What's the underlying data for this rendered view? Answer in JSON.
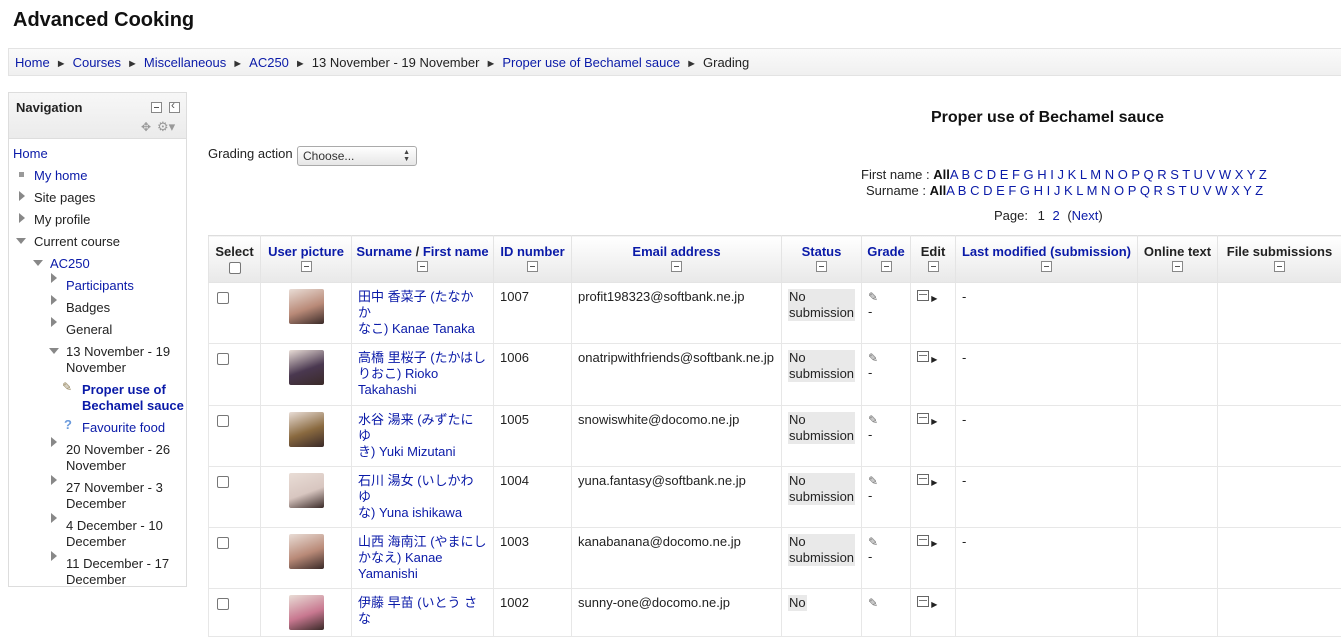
{
  "site": {
    "title": "Advanced Cooking"
  },
  "breadcrumb": [
    {
      "label": "Home",
      "link": true
    },
    {
      "label": "Courses",
      "link": true
    },
    {
      "label": "Miscellaneous",
      "link": true
    },
    {
      "label": "AC250",
      "link": true
    },
    {
      "label": "13 November - 19 November",
      "link": false
    },
    {
      "label": "Proper use of Bechamel sauce",
      "link": true
    },
    {
      "label": "Grading",
      "link": false
    }
  ],
  "navigation": {
    "title": "Navigation",
    "home": "Home",
    "my_home": "My home",
    "site_pages": "Site pages",
    "my_profile": "My profile",
    "current_course": "Current course",
    "course": "AC250",
    "participants": "Participants",
    "badges": "Badges",
    "general": "General",
    "week1": "13 November - 19 November",
    "assignment": "Proper use of Bechamel sauce",
    "favourite": "Favourite food",
    "week2": "20 November - 26 November",
    "week3": "27 November - 3 December",
    "week4": "4 December - 10 December",
    "week5": "11 December - 17 December"
  },
  "main": {
    "heading": "Proper use of Bechamel sauce",
    "grading_action_label": "Grading action",
    "grading_action_value": "Choose...",
    "first_name_label": "First name :",
    "surname_label": "Surname :",
    "all_label": "All",
    "letters": "A B C D E F G H I J K L M N O P Q R S T U V W X Y Z",
    "page_label": "Page:",
    "page_1": "1",
    "page_2": "2",
    "next_label": "Next"
  },
  "table": {
    "headers": {
      "select": "Select",
      "user_picture": "User picture",
      "surname": "Surname",
      "slash": " / ",
      "first_name": "First name",
      "id_number": "ID number",
      "email": "Email address",
      "status": "Status",
      "grade": "Grade",
      "edit": "Edit",
      "last_modified": "Last modified (submission)",
      "online_text": "Online text",
      "file_submissions": "File submissions"
    },
    "rows": [
      {
        "name_line1": "田中 香菜子 (たなか か",
        "name_line2": "なこ) Kanae Tanaka",
        "id": "1007",
        "email": "profit198323@softbank.ne.jp",
        "status1": "No",
        "status2": "submission",
        "grade": "-",
        "modified": "-",
        "avatar_color": "#b98a78"
      },
      {
        "name_line1": "高橋 里桜子 (たかはし",
        "name_line2": "りおこ) Rioko",
        "name_line3": "Takahashi",
        "id": "1006",
        "email": "onatripwithfriends@softbank.ne.jp",
        "status1": "No",
        "status2": "submission",
        "grade": "-",
        "modified": "-",
        "avatar_color": "#4a3850"
      },
      {
        "name_line1": "水谷 湯来 (みずたに ゆ",
        "name_line2": "き) Yuki Mizutani",
        "id": "1005",
        "email": "snowiswhite@docomo.ne.jp",
        "status1": "No",
        "status2": "submission",
        "grade": "-",
        "modified": "-",
        "avatar_color": "#8a6a40"
      },
      {
        "name_line1": "石川 湯女 (いしかわ ゆ",
        "name_line2": "な) Yuna ishikawa",
        "id": "1004",
        "email": "yuna.fantasy@softbank.ne.jp",
        "status1": "No",
        "status2": "submission",
        "grade": "-",
        "modified": "-",
        "avatar_color": "#d8c6c0"
      },
      {
        "name_line1": "山西 海南江 (やまにし",
        "name_line2": "かなえ) Kanae",
        "name_line3": "Yamanishi",
        "id": "1003",
        "email": "kanabanana@docomo.ne.jp",
        "status1": "No",
        "status2": "submission",
        "grade": "-",
        "modified": "-",
        "avatar_color": "#b98a78"
      },
      {
        "name_line1": "伊藤 早苗 (いとう さな",
        "name_line2": "",
        "id": "1002",
        "email": "sunny-one@docomo.ne.jp",
        "status1": "No",
        "status2": "",
        "grade": "",
        "modified": "",
        "avatar_color": "#c87890"
      }
    ]
  }
}
